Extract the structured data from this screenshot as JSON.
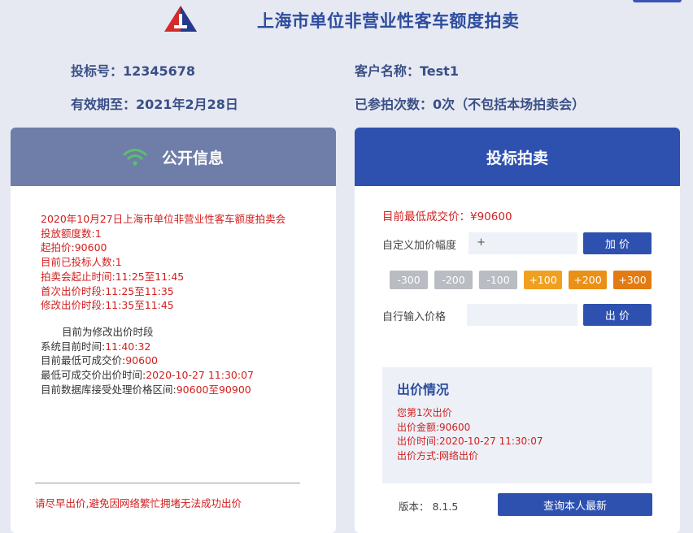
{
  "header": {
    "title": "上海市单位非营业性客车额度拍卖"
  },
  "info": {
    "bid_no": "投标号：12345678",
    "customer": "客户名称：Test1",
    "valid_until": "有效期至：2021年2月28日",
    "attend_count": "已参拍次数：0次（不包括本场拍卖会）"
  },
  "public_panel": {
    "title": "公开信息",
    "lines_red": [
      "2020年10月27日上海市单位非营业性客车额度拍卖会",
      "投放额度数:1",
      "起拍价:90600",
      "目前已投标人数:1",
      "拍卖会起止时间:11:25至11:45",
      "首次出价时段:11:25至11:35",
      "修改出价时段:11:35至11:45"
    ],
    "phase": "目前为修改出价时段",
    "sys_time_label": "系统目前时间:",
    "sys_time_value": "11:40:32",
    "min_price_label": "目前最低可成交价:",
    "min_price_value": "90600",
    "min_time_label": "最低可成交价出价时间:",
    "min_time_value": "2020-10-27 11:30:07",
    "range_label": "目前数据库接受处理价格区间:",
    "range_value": "90600至90900",
    "footer_note": "请尽早出价,避免因网络繁忙拥堵无法成功出价"
  },
  "bid_panel": {
    "title": "投标拍卖",
    "lowest_price": "目前最低成交价：¥90600",
    "custom_label": "自定义加价幅度",
    "custom_value": "+",
    "add_button": "加 价",
    "steps": [
      "-300",
      "-200",
      "-100",
      "+100",
      "+200",
      "+300"
    ],
    "input_label": "自行输入价格",
    "input_value": "",
    "bid_button": "出 价",
    "status_title": "出价情况",
    "status_lines": [
      "您第1次出价",
      "出价金额:90600",
      "出价时间:2020-10-27 11:30:07",
      "出价方式:网络出价"
    ],
    "version": "版本：  8.1.5",
    "query_button": "查询本人最新"
  },
  "colors": {
    "brand_blue": "#2e51b0",
    "panel_gray_blue": "#6f7ea8",
    "alert_red": "#d11f1f",
    "step_orange": "#f0a020"
  }
}
